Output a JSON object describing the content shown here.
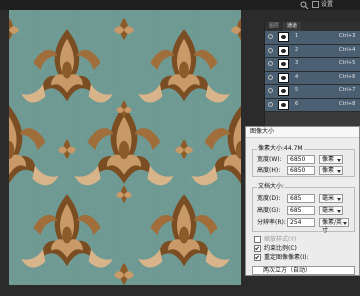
{
  "topbar": {
    "search_icon": "search-icon",
    "settings_label": "设置",
    "settings_icon": "window-icon"
  },
  "layers_panel": {
    "tabs": [
      "图层",
      "通道"
    ],
    "active_tab": "通道",
    "rows": [
      {
        "name": "1",
        "shortcut": "Ctrl+3"
      },
      {
        "name": "2",
        "shortcut": "Ctrl+4"
      },
      {
        "name": "3",
        "shortcut": "Ctrl+5"
      },
      {
        "name": "4",
        "shortcut": "Ctrl+6"
      },
      {
        "name": "5",
        "shortcut": "Ctrl+7"
      },
      {
        "name": "6",
        "shortcut": "Ctrl+8"
      }
    ]
  },
  "dialog": {
    "title": "图像大小",
    "pixel_size_label": "像素大小:44.7M",
    "pixel_group": {
      "width_label": "宽度(W):",
      "width_value": "6850",
      "width_unit": "像素",
      "height_label": "高度(H):",
      "height_value": "6850",
      "height_unit": "像素"
    },
    "document_group": {
      "title": "文档大小:",
      "width_label": "宽度(D):",
      "width_value": "685",
      "width_unit": "毫米",
      "height_label": "高度(G):",
      "height_value": "685",
      "height_unit": "毫米",
      "resolution_label": "分辨率(R):",
      "resolution_value": "254",
      "resolution_unit": "像素/英寸"
    },
    "checkboxes": [
      {
        "label": "缩放样式(Y)",
        "checked": false,
        "disabled": true
      },
      {
        "label": "约束比例(C)",
        "checked": true,
        "disabled": false
      },
      {
        "label": "重定图像像素(I):",
        "checked": true,
        "disabled": false
      }
    ],
    "resample_value": "两次立方（自动）"
  },
  "colors": {
    "canvas_bg": "#6f9a93",
    "ornament_dark": "#7a4e22",
    "ornament_light": "#d8b48a",
    "layer_row_bg": "#4b5f73"
  }
}
